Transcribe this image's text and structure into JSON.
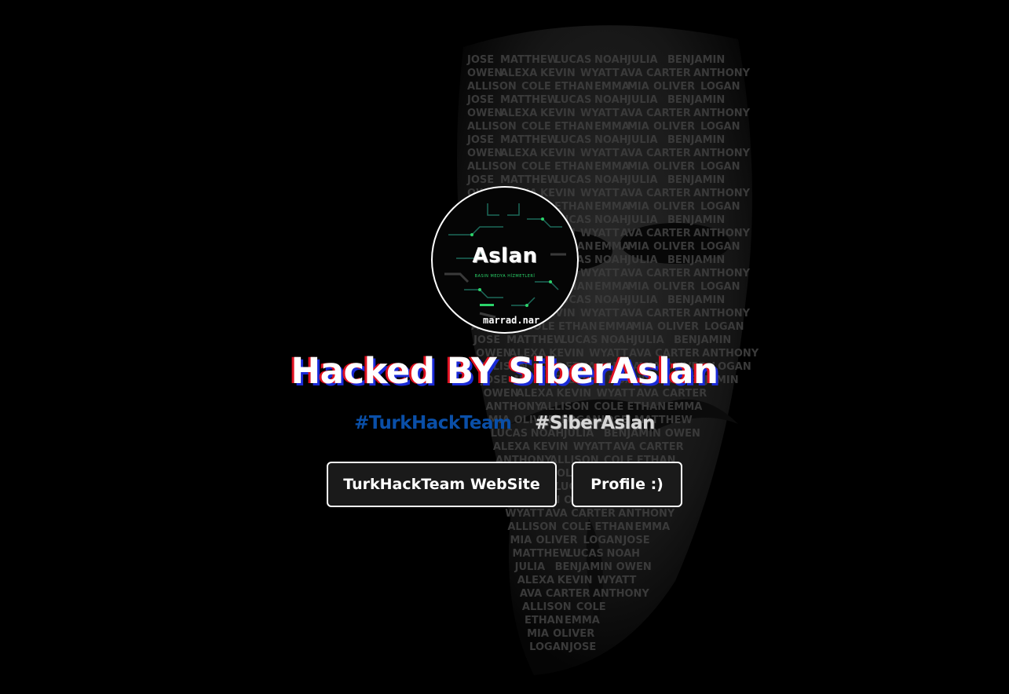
{
  "page": {
    "background_color": "#000000"
  },
  "avatar": {
    "logo_text": "Aslan",
    "tagline": "BASIN MEDYA HİZMETLERİ",
    "handle": "marrad.nar"
  },
  "title": {
    "text": "Hacked BY SiberAslan",
    "fill_color": "#ffffff",
    "shadow_colors": [
      "#e01020",
      "#1a2ad8"
    ]
  },
  "hashtags": [
    {
      "text": "#TurkHackTeam",
      "color": "#0a4fa8"
    },
    {
      "text": "#SiberAslan",
      "color": "#d8d8d8"
    }
  ],
  "buttons": {
    "website_label": "TurkHackTeam WebSite",
    "profile_label": "Profile :)"
  },
  "background": {
    "icon": "anonymous-mask-icon",
    "name_texts": [
      "JOSE",
      "ALEXA",
      "COLE",
      "MATTHEW",
      "KEVIN",
      "ETHAN",
      "LUCAS",
      "WYATT",
      "EMMA",
      "NOAH",
      "AVA",
      "MIA",
      "JULIA",
      "CARTER",
      "OLIVER",
      "BENJAMIN",
      "ANTHONY",
      "LOGAN",
      "OWEN",
      "ALLISON"
    ]
  }
}
